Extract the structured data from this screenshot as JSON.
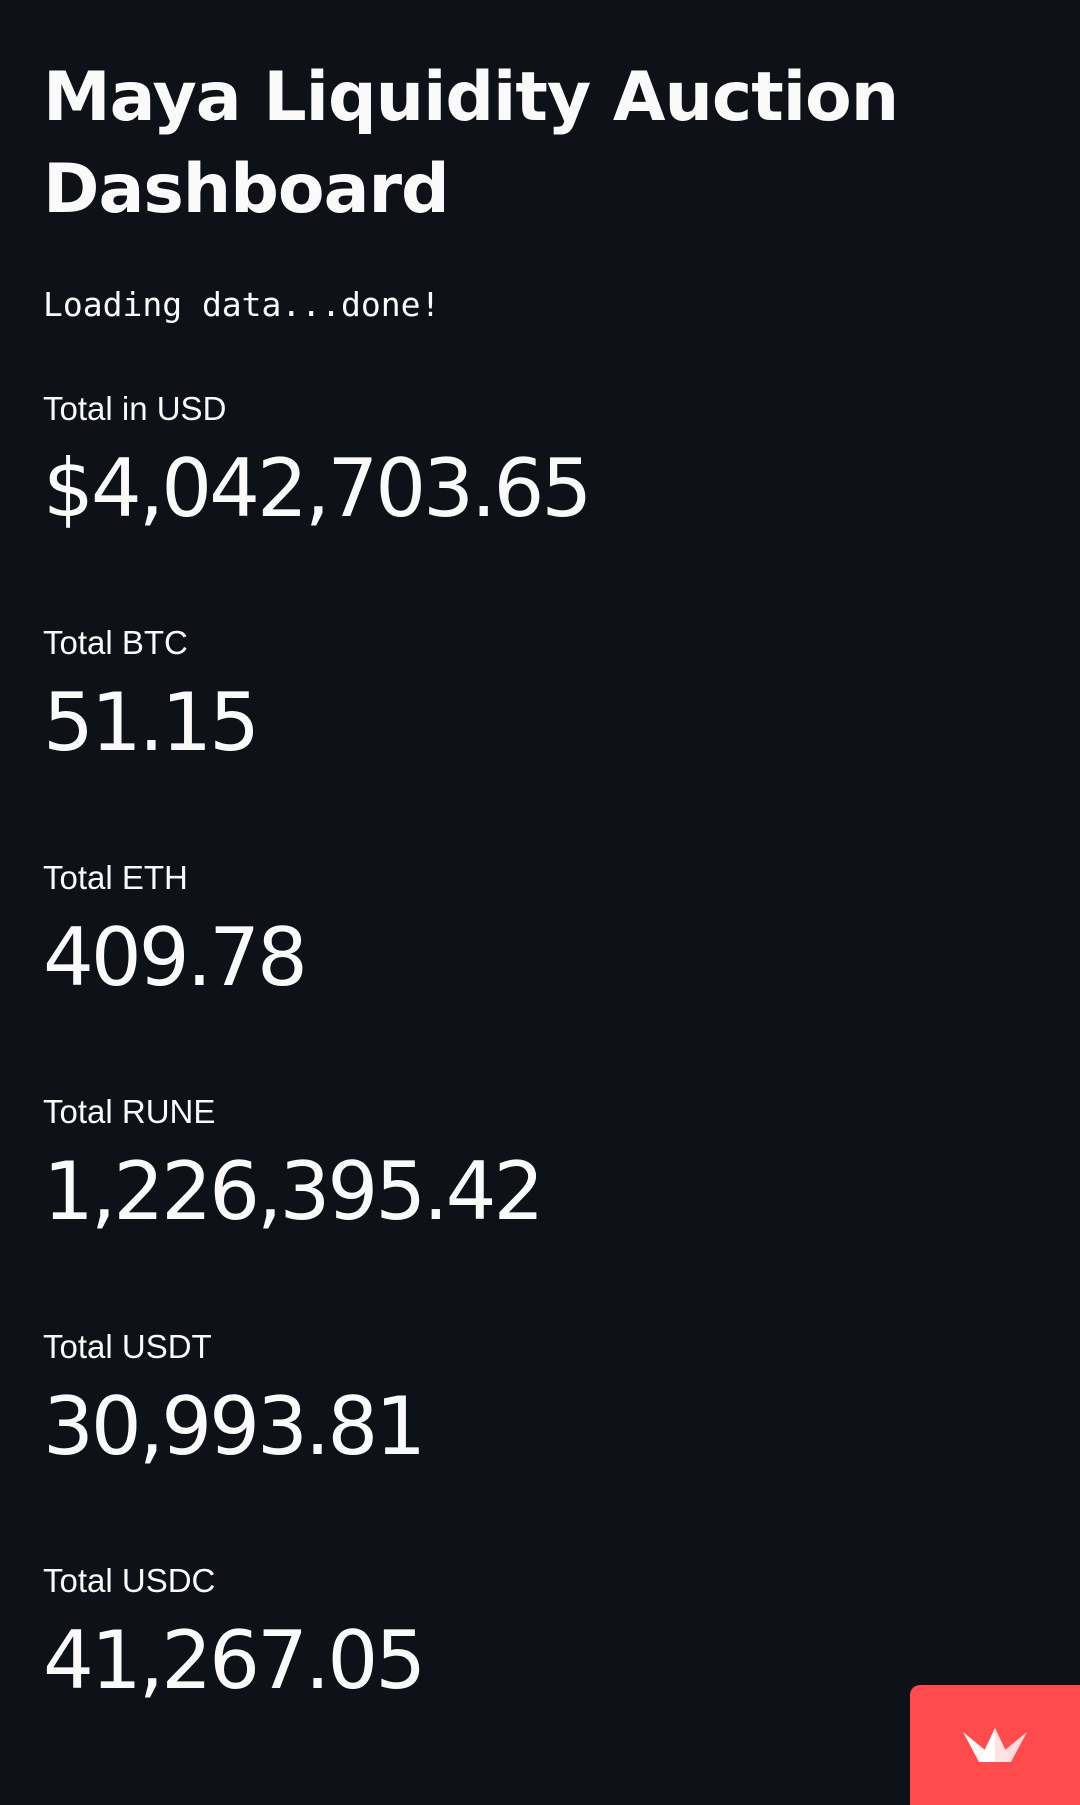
{
  "title": "Maya Liquidity Auction Dashboard",
  "status": "Loading data...done!",
  "metrics": [
    {
      "label": "Total in USD",
      "value": "$4,042,703.65"
    },
    {
      "label": "Total BTC",
      "value": "51.15"
    },
    {
      "label": "Total ETH",
      "value": "409.78"
    },
    {
      "label": "Total RUNE",
      "value": "1,226,395.42"
    },
    {
      "label": "Total USDT",
      "value": "30,993.81"
    },
    {
      "label": "Total USDC",
      "value": "41,267.05"
    }
  ],
  "colors": {
    "background": "#0e1117",
    "text": "#fafafa",
    "badge": "#ff4b4b"
  },
  "badge_icon": "streamlit-crown-icon"
}
